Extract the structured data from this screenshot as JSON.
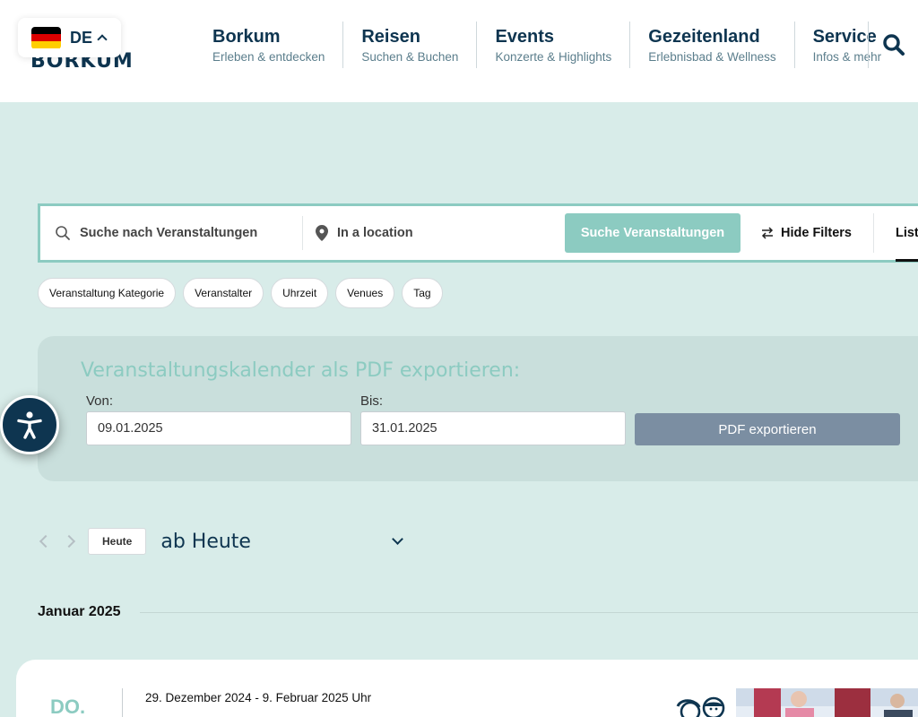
{
  "header": {
    "language": {
      "code": "DE",
      "flag_colors": [
        "#000000",
        "#dd0000",
        "#ffce00"
      ]
    },
    "logo_text": "BORKUM",
    "nav": [
      {
        "title": "Borkum",
        "subtitle": "Erleben & entdecken"
      },
      {
        "title": "Reisen",
        "subtitle": "Suchen & Buchen"
      },
      {
        "title": "Events",
        "subtitle": "Konzerte & Highlights"
      },
      {
        "title": "Gezeitenland",
        "subtitle": "Erlebnisbad & Wellness"
      },
      {
        "title": "Service",
        "subtitle": "Infos & mehr"
      }
    ],
    "search_icon": "search-icon"
  },
  "search": {
    "keyword_placeholder": "Suche nach Veranstaltungen",
    "location_placeholder": "In a location",
    "submit_label": "Suche Veranstaltungen",
    "filters_label": "Hide Filters",
    "view_label": "List"
  },
  "filters": [
    "Veranstaltung Kategorie",
    "Veranstalter",
    "Uhrzeit",
    "Venues",
    "Tag"
  ],
  "pdf_export": {
    "title": "Veranstaltungskalender als PDF exportieren:",
    "from_label": "Von:",
    "from_value": "09.01.2025",
    "to_label": "Bis:",
    "to_value": "31.01.2025",
    "button_label": "PDF exportieren"
  },
  "date_nav": {
    "today_label": "Heute",
    "range_label": "ab Heute"
  },
  "month_label": "Januar 2025",
  "event": {
    "day_label": "DO.",
    "date_range": "29. Dezember 2024 - 9. Februar 2025 Uhr"
  },
  "colors": {
    "navy": "#0e3550",
    "teal": "#8ccbc1",
    "background": "#d8ece9",
    "pdf_button": "#7b8ea2"
  }
}
